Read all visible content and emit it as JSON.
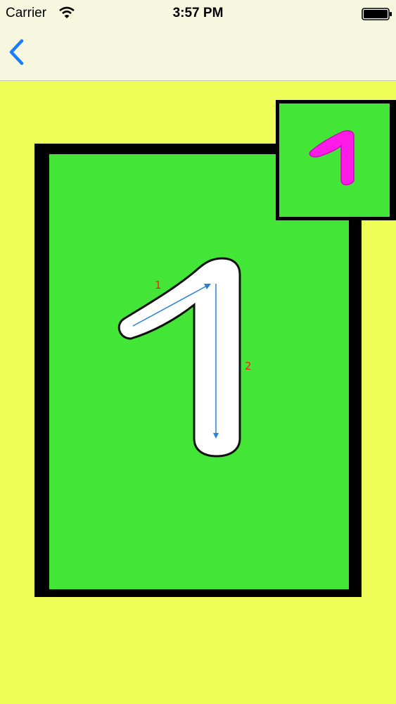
{
  "status_bar": {
    "carrier": "Carrier",
    "time": "3:57 PM"
  },
  "nav": {
    "back_icon": "chevron-left-icon",
    "accent_color": "#1a7ff7"
  },
  "tracing": {
    "character": "1",
    "stroke_labels": [
      "1",
      "2"
    ],
    "board_color": "#43e637",
    "background_color": "#eefc57",
    "preview_color": "#ff1ae8"
  }
}
